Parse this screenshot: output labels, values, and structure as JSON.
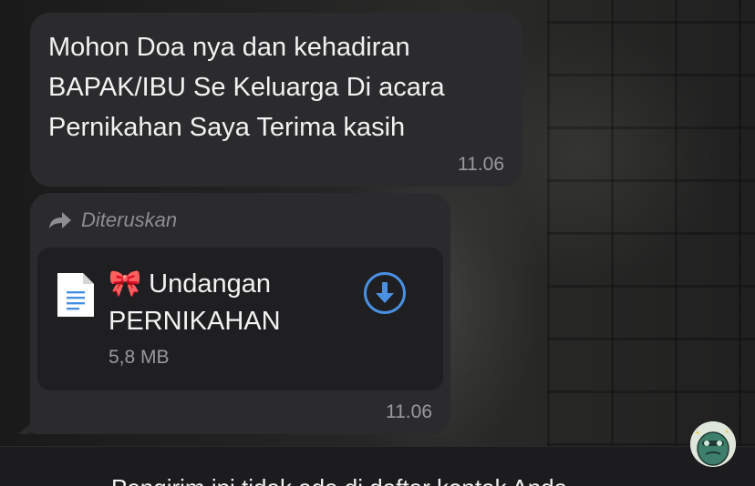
{
  "messages": [
    {
      "text": "Mohon Doa nya dan kehadiran BAPAK/IBU Se Keluarga Di acara Pernikahan Saya Terima kasih",
      "time": "11.06"
    },
    {
      "forwarded_label": "Diteruskan",
      "document": {
        "emoji": "🎀",
        "title": "Undangan PERNIKAHAN",
        "size": "5,8 MB",
        "icon": "document-icon"
      },
      "download_icon": "download-arrow-icon",
      "time": "11.06"
    }
  ],
  "bottom_notice": "Pengirim ini tidak ada di daftar kontak Anda",
  "colors": {
    "bubble": "#2b2b2d",
    "card": "#1f1f21",
    "accent": "#4a90e2",
    "muted": "#9a9a9c"
  }
}
